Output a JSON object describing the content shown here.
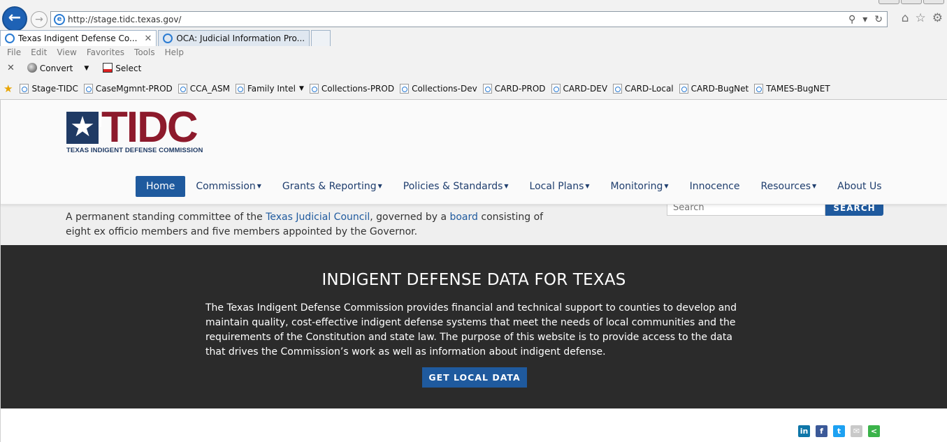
{
  "browser": {
    "url": "http://stage.tidc.texas.gov/",
    "tabs": [
      {
        "label": "Texas Indigent Defense Co...",
        "active": true
      },
      {
        "label": "OCA: Judicial Information Pro...",
        "active": false
      }
    ],
    "menu": [
      "File",
      "Edit",
      "View",
      "Favorites",
      "Tools",
      "Help"
    ],
    "commands": {
      "convert": "Convert",
      "select": "Select"
    },
    "favorites": [
      "Stage-TIDC",
      "CaseMgmnt-PROD",
      "CCA_ASM",
      "Family Intel",
      "Collections-PROD",
      "Collections-Dev",
      "CARD-PROD",
      "CARD-DEV",
      "CARD-Local",
      "CARD-BugNet",
      "TAMES-BugNET"
    ]
  },
  "site": {
    "logo": {
      "wordmark": "TIDC",
      "tagline": "TEXAS INDIGENT DEFENSE COMMISSION"
    },
    "nav": [
      {
        "label": "Home",
        "active": true,
        "dropdown": false
      },
      {
        "label": "Commission",
        "active": false,
        "dropdown": true
      },
      {
        "label": "Grants & Reporting",
        "active": false,
        "dropdown": true
      },
      {
        "label": "Policies & Standards",
        "active": false,
        "dropdown": true
      },
      {
        "label": "Local Plans",
        "active": false,
        "dropdown": true
      },
      {
        "label": "Monitoring",
        "active": false,
        "dropdown": true
      },
      {
        "label": "Innocence",
        "active": false,
        "dropdown": false
      },
      {
        "label": "Resources",
        "active": false,
        "dropdown": true
      },
      {
        "label": "About Us",
        "active": false,
        "dropdown": false
      }
    ],
    "intro": {
      "part1": "A permanent standing committee of the ",
      "link1": "Texas Judicial Council",
      "part2": ", governed by a ",
      "link2": "board",
      "part3": " consisting of eight ex officio members and five members appointed by the Governor."
    },
    "search": {
      "placeholder": "Search",
      "button": "SEARCH"
    },
    "hero": {
      "title": "INDIGENT DEFENSE DATA FOR TEXAS",
      "body": "The Texas Indigent Defense Commission provides financial and technical support to counties to develop and maintain quality, cost-effective indigent defense systems that meet the needs of local communities and the requirements of the Constitution and state law. The purpose of this website is to provide access to the data that drives the Commission’s work as well as information about indigent defense.",
      "cta": "GET LOCAL DATA"
    },
    "share": [
      {
        "icon": "linkedin-icon",
        "glyph": "in",
        "color": "#0e76a8"
      },
      {
        "icon": "facebook-icon",
        "glyph": "f",
        "color": "#3b5998"
      },
      {
        "icon": "twitter-icon",
        "glyph": "t",
        "color": "#1da1f2"
      },
      {
        "icon": "email-icon",
        "glyph": "✉",
        "color": "#c9c9c9"
      },
      {
        "icon": "share-icon",
        "glyph": "<",
        "color": "#3bb34a"
      }
    ]
  }
}
